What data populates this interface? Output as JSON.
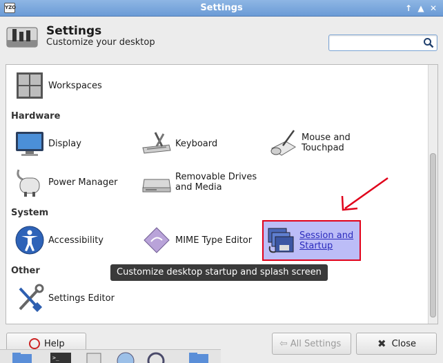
{
  "window": {
    "title": "Settings",
    "app_icon_text": "YZO"
  },
  "header": {
    "title": "Settings",
    "subtitle": "Customize your desktop"
  },
  "search": {
    "placeholder": "",
    "value": ""
  },
  "items": {
    "workspaces": "Workspaces",
    "display": "Display",
    "keyboard": "Keyboard",
    "mouse_line1": "Mouse and",
    "mouse_line2": "Touchpad",
    "power": "Power Manager",
    "removable_line1": "Removable Drives",
    "removable_line2": "and Media",
    "accessibility": "Accessibility",
    "mime": "MIME Type Editor",
    "session_line1": "Session and",
    "session_line2": "Startup",
    "settings_editor": "Settings Editor"
  },
  "sections": {
    "hardware": "Hardware",
    "system": "System",
    "other": "Other"
  },
  "tooltip": "Customize desktop startup and splash screen",
  "buttons": {
    "help": "Help",
    "all_settings": "All Settings",
    "close": "Close"
  },
  "colors": {
    "highlight": "#bcbdf7",
    "annotation": "#e0001a",
    "titlebar": "#7ba7de"
  }
}
